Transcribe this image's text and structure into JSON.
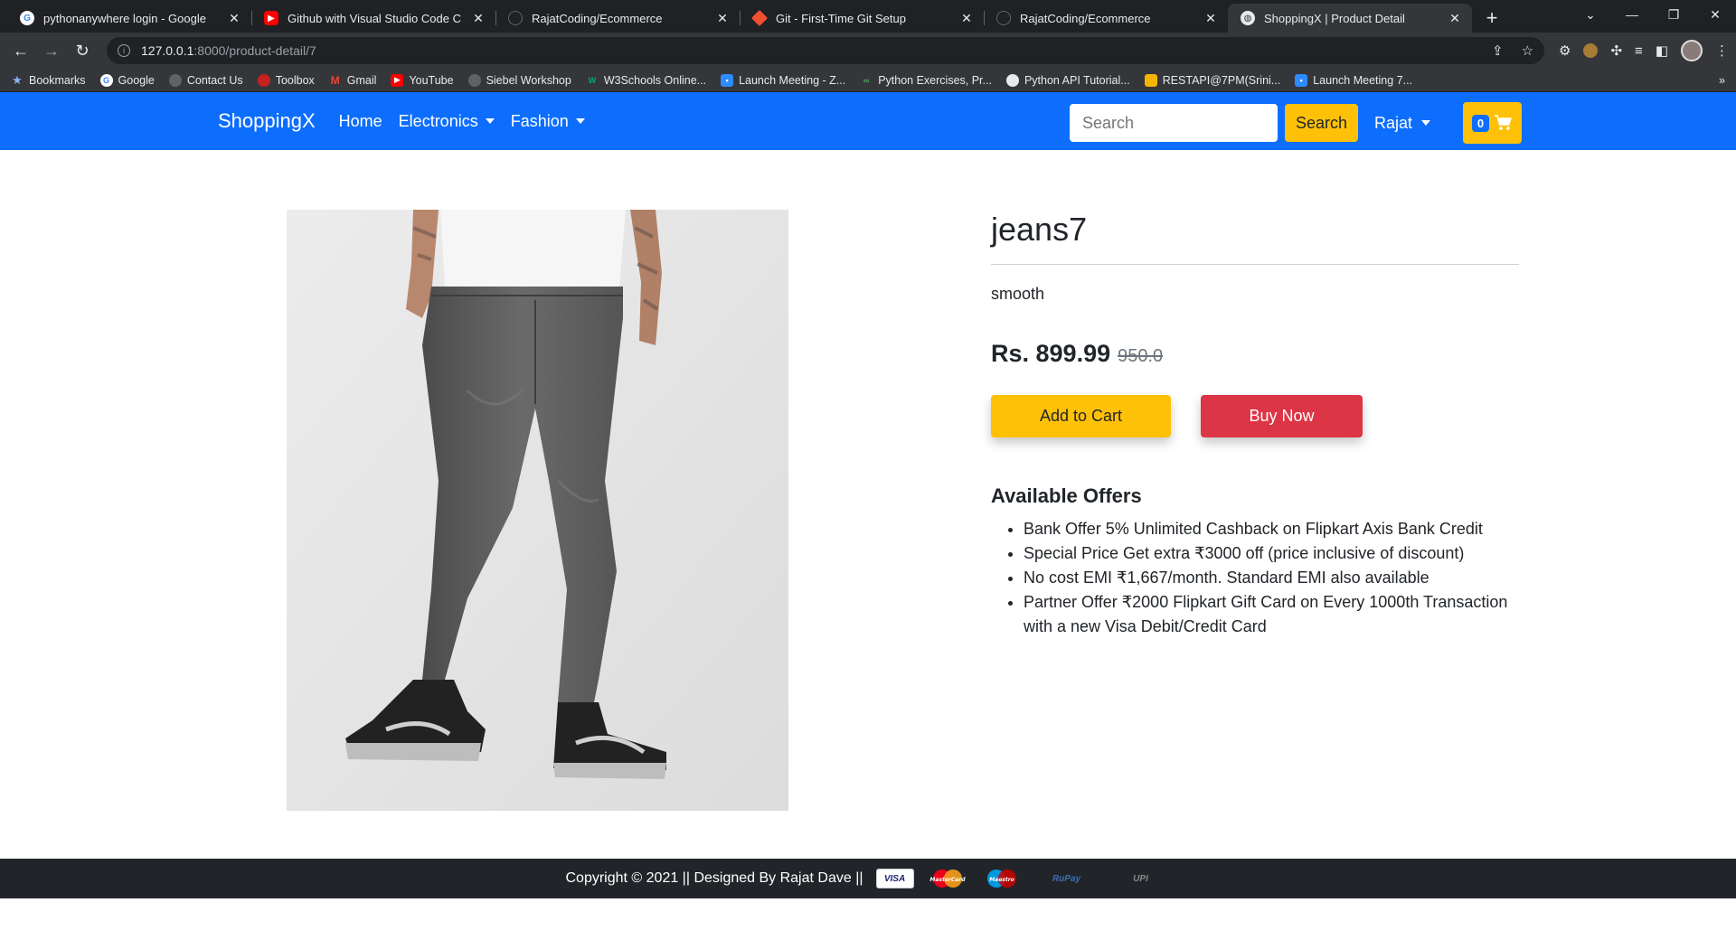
{
  "browser": {
    "tabs": [
      {
        "title": "pythonanywhere login - Google",
        "favicon": "google-icon",
        "active": false
      },
      {
        "title": "Github with Visual Studio Code C",
        "favicon": "youtube-icon",
        "active": false
      },
      {
        "title": "RajatCoding/Ecommerce",
        "favicon": "github-icon",
        "active": false
      },
      {
        "title": "Git - First-Time Git Setup",
        "favicon": "git-icon",
        "active": false
      },
      {
        "title": "RajatCoding/Ecommerce",
        "favicon": "github-icon",
        "active": false
      },
      {
        "title": "ShoppingX | Product Detail",
        "favicon": "globe-icon",
        "active": true
      }
    ],
    "url_host": "127.0.0.1",
    "url_path": ":8000/product-detail/7",
    "bookmarks": [
      {
        "label": "Bookmarks",
        "icon": "star-icon"
      },
      {
        "label": "Google",
        "icon": "google-icon"
      },
      {
        "label": "Contact Us",
        "icon": "globe-icon"
      },
      {
        "label": "Toolbox",
        "icon": "toolbox-icon"
      },
      {
        "label": "Gmail",
        "icon": "gmail-icon"
      },
      {
        "label": "YouTube",
        "icon": "youtube-icon"
      },
      {
        "label": "Siebel Workshop",
        "icon": "globe-icon"
      },
      {
        "label": "W3Schools Online...",
        "icon": "w3schools-icon"
      },
      {
        "label": "Launch Meeting - Z...",
        "icon": "zoom-icon"
      },
      {
        "label": "Python Exercises, Pr...",
        "icon": "w3resource-icon"
      },
      {
        "label": "Python API Tutorial...",
        "icon": "python-icon"
      },
      {
        "label": "RESTAPI@7PM(Srini...",
        "icon": "classroom-icon"
      },
      {
        "label": "Launch Meeting 7...",
        "icon": "zoom-icon"
      }
    ]
  },
  "navbar": {
    "brand": "ShoppingX",
    "links": {
      "home": "Home",
      "electronics": "Electronics",
      "fashion": "Fashion"
    },
    "search_placeholder": "Search",
    "search_button": "Search",
    "user": "Rajat",
    "cart_count": "0"
  },
  "product": {
    "title": "jeans7",
    "description": "smooth",
    "price": "Rs. 899.99",
    "old_price": "950.0",
    "add_to_cart": "Add to Cart",
    "buy_now": "Buy Now",
    "offers_title": "Available Offers",
    "offers": [
      "Bank Offer 5% Unlimited Cashback on Flipkart Axis Bank Credit",
      "Special Price Get extra ₹3000 off (price inclusive of discount)",
      "No cost EMI ₹1,667/month. Standard EMI also available",
      "Partner Offer ₹2000 Flipkart Gift Card on Every 1000th Transaction with a new Visa Debit/Credit Card"
    ]
  },
  "footer": {
    "text": "Copyright © 2021 || Designed By Rajat Dave ||",
    "payments": {
      "visa": "VISA",
      "mastercard": "MasterCard",
      "maestro": "Maestro",
      "rupay": "RuPay",
      "upi": "UPI"
    }
  }
}
